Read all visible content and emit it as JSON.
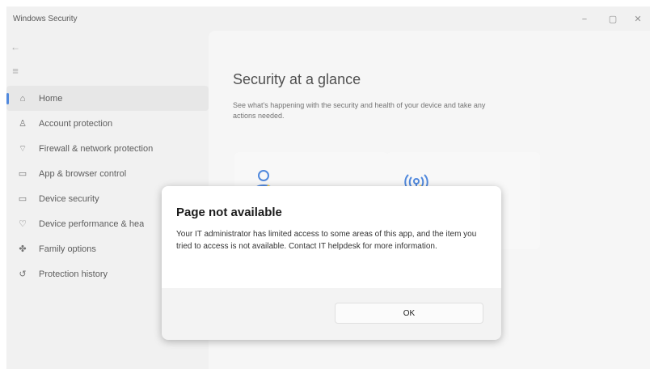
{
  "window": {
    "title": "Windows Security",
    "controls": {
      "minimize": "−",
      "maximize": "▢",
      "close": "✕"
    }
  },
  "nav": {
    "back_glyph": "←",
    "menu_glyph": "≡",
    "items": [
      {
        "label": "Home",
        "icon": "home-icon",
        "glyph": "⌂",
        "active": true
      },
      {
        "label": "Account protection",
        "icon": "person-icon",
        "glyph": "♙",
        "active": false
      },
      {
        "label": "Firewall & network protection",
        "icon": "wifi-icon",
        "glyph": "⌔",
        "active": false
      },
      {
        "label": "App & browser control",
        "icon": "app-window-icon",
        "glyph": "▭",
        "active": false
      },
      {
        "label": "Device security",
        "icon": "laptop-icon",
        "glyph": "▭",
        "active": false
      },
      {
        "label": "Device performance & hea",
        "icon": "heart-icon",
        "glyph": "♡",
        "active": false
      },
      {
        "label": "Family options",
        "icon": "family-icon",
        "glyph": "✤",
        "active": false
      },
      {
        "label": "Protection history",
        "icon": "history-icon",
        "glyph": "↺",
        "active": false
      }
    ]
  },
  "main": {
    "heading": "Security at a glance",
    "description": "See what's happening with the security and health of your device and take any actions needed.",
    "tiles": [
      {
        "icon": "account-protection-icon"
      },
      {
        "icon": "firewall-broadcast-icon"
      }
    ]
  },
  "dialog": {
    "title": "Page not available",
    "message": "Your IT administrator has limited access to some areas of this app, and the item you tried to access is not available. Contact IT helpdesk for more information.",
    "ok_label": "OK"
  },
  "colors": {
    "accent": "#2b6fd6",
    "warning": "#f2c318",
    "sidebar_bg": "#eeeeee",
    "content_bg": "#f4f4f4",
    "dialog_footer": "#f3f3f3"
  }
}
